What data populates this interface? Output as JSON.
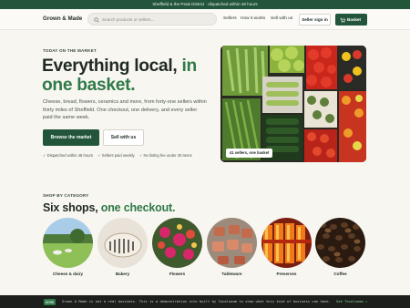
{
  "announcement": "Sheffield & the Peak District · dispatched within 48 hours",
  "nav": {
    "logo": "Grown & Made",
    "search_placeholder": "Search products or sellers...",
    "links": [
      "Sellers",
      "How it works",
      "Sell with us"
    ],
    "signin_label": "Seller sign in",
    "basket_label": "Basket"
  },
  "hero": {
    "eyebrow": "TODAY ON THE MARKET",
    "headline_part1": "Everything local, ",
    "headline_highlight": "in one basket.",
    "subtext": "Cheese, bread, flowers, ceramics and more, from forty-one sellers within thirty miles of Sheffield. One checkout, one delivery, and every seller paid the same week.",
    "primary_cta": "Browse the market",
    "secondary_cta": "Sell with us",
    "assurances": [
      "✓ Dispatched within 48 hours",
      "✓ Sellers paid weekly",
      "✓ No listing fee under 20 items"
    ],
    "image_caption": "41 sellers, one basket"
  },
  "categories": {
    "eyebrow": "SHOP BY CATEGORY",
    "title_part1": "Six shops, ",
    "title_highlight": "one checkout.",
    "items": [
      {
        "label": "Cheese & dairy"
      },
      {
        "label": "Bakery"
      },
      {
        "label": "Flowers"
      },
      {
        "label": "Tableware"
      },
      {
        "label": "Preserves"
      },
      {
        "label": "Coffee"
      }
    ]
  },
  "footer": {
    "badge": "DEMO",
    "text": "Grown & Made is not a real business. This is a demonstration site built by Tocalsoom to show what this kind of business can have.",
    "link": "See Tocalsoom ↗"
  },
  "colors": {
    "brand_green": "#23553a",
    "accent_green": "#2f7a48",
    "background": "#f8f6f1"
  }
}
